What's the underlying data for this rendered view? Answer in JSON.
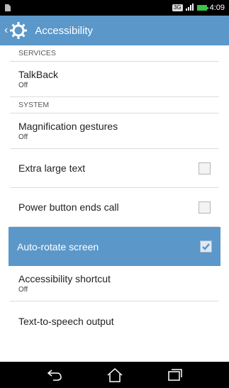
{
  "status_bar": {
    "network_badge": "3G",
    "time": "4:09",
    "icons": [
      "sim-icon",
      "signal-icon",
      "battery-icon"
    ]
  },
  "action_bar": {
    "title": "Accessibility",
    "icon": "gear-icon"
  },
  "sections": {
    "services": {
      "label": "SERVICES"
    },
    "system": {
      "label": "SYSTEM"
    }
  },
  "items": {
    "talkback": {
      "label": "TalkBack",
      "summary": "Off"
    },
    "magnification": {
      "label": "Magnification gestures",
      "summary": "Off"
    },
    "large_text": {
      "label": "Extra large text",
      "checked": false
    },
    "power_button": {
      "label": "Power button ends call",
      "checked": false
    },
    "auto_rotate": {
      "label": "Auto-rotate screen",
      "checked": true
    },
    "shortcut": {
      "label": "Accessibility shortcut",
      "summary": "Off"
    },
    "tts": {
      "label": "Text-to-speech output"
    }
  },
  "colors": {
    "accent": "#5b97c9",
    "status_bar": "#000000",
    "battery": "#39c44a"
  }
}
